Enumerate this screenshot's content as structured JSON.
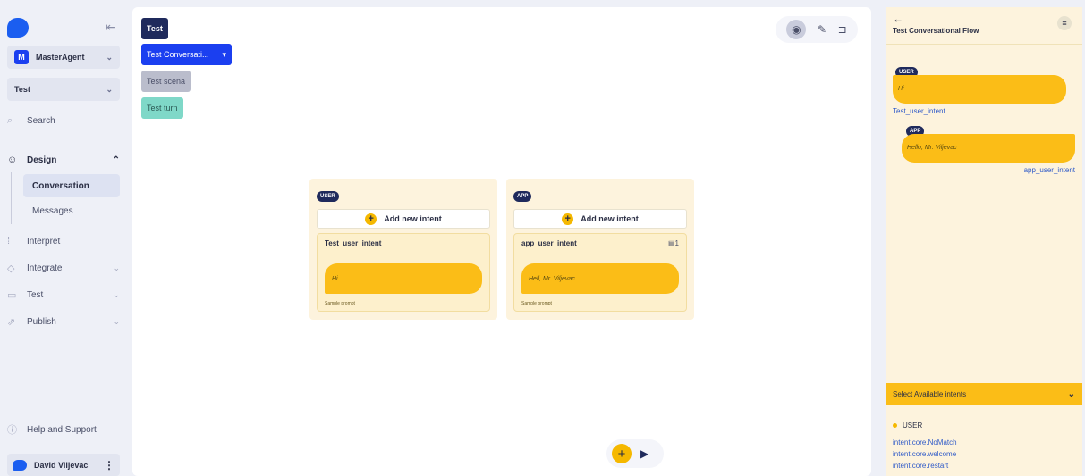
{
  "sidebar": {
    "agent": {
      "initial": "M",
      "name": "MasterAgent"
    },
    "project": "Test",
    "search": "Search",
    "design": "Design",
    "sub_items": [
      "Conversation",
      "Messages"
    ],
    "items": [
      "Interpret",
      "Integrate",
      "Test",
      "Publish"
    ],
    "help": "Help and Support",
    "user": "David Viljevac"
  },
  "canvas": {
    "chips": [
      "Test",
      "Test Conversati...",
      "Test scena",
      "Test turn"
    ],
    "user_panel": {
      "role": "USER",
      "add": "Add new intent",
      "intent": "Test_user_intent",
      "prompt": "Hi",
      "hint": "Sample prompt"
    },
    "app_panel": {
      "role": "APP",
      "add": "Add new intent",
      "intent": "app_user_intent",
      "count": "1",
      "prompt": "Hell, Mr. Viljevac",
      "hint": "Sample prompt"
    }
  },
  "right_panel": {
    "back": "←",
    "title": "Test Conversational Flow",
    "user_role": "USER",
    "user_msg": "Hi",
    "user_intent": "Test_user_intent",
    "app_role": "APP",
    "app_msg": "Hello, Mr. Viljevac",
    "app_intent": "app_user_intent",
    "select_label": "Select Available intents",
    "list_header": "USER",
    "intents": [
      "intent.core.NoMatch",
      "intent.core.welcome",
      "intent.core.restart"
    ]
  },
  "colors": {
    "accent": "#1b3ff0",
    "yellow": "#fbbd17",
    "navy": "#1f2a5c"
  }
}
